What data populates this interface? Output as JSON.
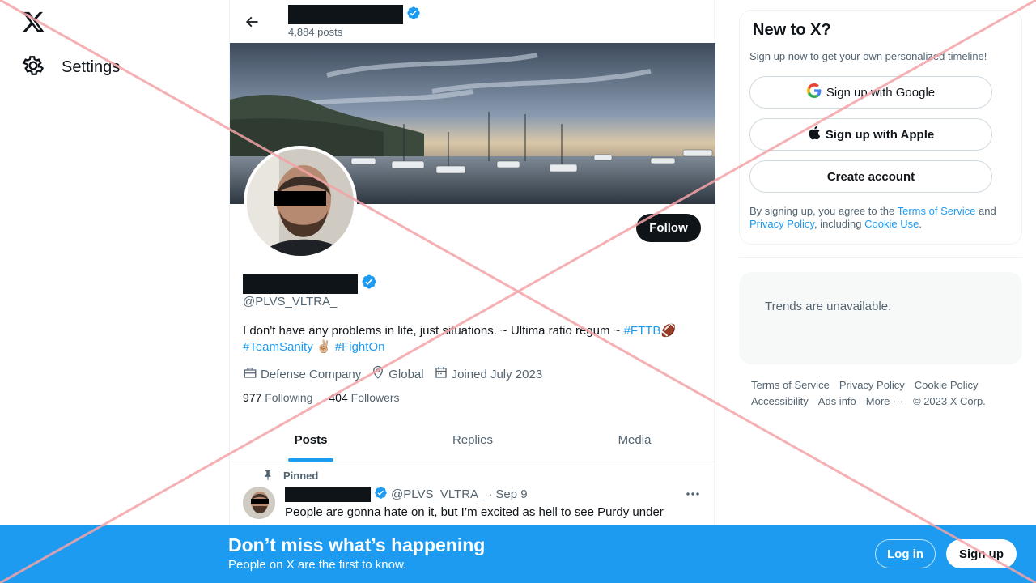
{
  "sidebar": {
    "logo": "x-logo",
    "settings_label": "Settings"
  },
  "header": {
    "posts_count": "4,884 posts"
  },
  "profile": {
    "handle": "@PLVS_VLTRA_",
    "bio_text": "I don't have any problems in life, just situations. ~ Ultima ratio regum ~ ",
    "bio_tags": [
      "#FTTB",
      "#TeamSanity",
      "#FightOn"
    ],
    "bio_emoji_1": "🏈",
    "bio_emoji_2": "✌🏼",
    "category": "Defense Company",
    "location": "Global",
    "joined": "Joined July 2023",
    "following_count": "977",
    "following_label": "Following",
    "followers_count": "404",
    "followers_label": "Followers",
    "follow_button": "Follow"
  },
  "tabs": [
    {
      "label": "Posts",
      "active": true
    },
    {
      "label": "Replies",
      "active": false
    },
    {
      "label": "Media",
      "active": false
    }
  ],
  "post": {
    "pinned_label": "Pinned",
    "handle": "@PLVS_VLTRA_",
    "separator": "·",
    "date": "Sep 9",
    "text": "People are gonna hate on it, but I’m excited as hell to see Purdy under"
  },
  "signup_card": {
    "title": "New to X?",
    "subtitle": "Sign up now to get your own personalized timeline!",
    "google_label": "Sign up with Google",
    "apple_label": "Sign up with Apple",
    "create_label": "Create account",
    "legal_prefix": "By signing up, you agree to the ",
    "terms_link": "Terms of Service",
    "legal_and": " and ",
    "privacy_link": "Privacy Policy",
    "legal_including": ", including ",
    "cookie_link": "Cookie Use",
    "legal_suffix": "."
  },
  "trends": {
    "message": "Trends are unavailable."
  },
  "footer": {
    "links_row1": [
      "Terms of Service",
      "Privacy Policy",
      "Cookie Policy"
    ],
    "links_row2": [
      "Accessibility",
      "Ads info",
      "More ···"
    ],
    "copyright": "© 2023 X Corp."
  },
  "bottom_banner": {
    "title": "Don’t miss what’s happening",
    "subtitle": "People on X are the first to know.",
    "login_label": "Log in",
    "signup_label": "Sign up"
  },
  "colors": {
    "accent": "#1d9bf0",
    "text": "#0f1419",
    "muted": "#536471",
    "overlay_red": "#f4a3a8"
  }
}
